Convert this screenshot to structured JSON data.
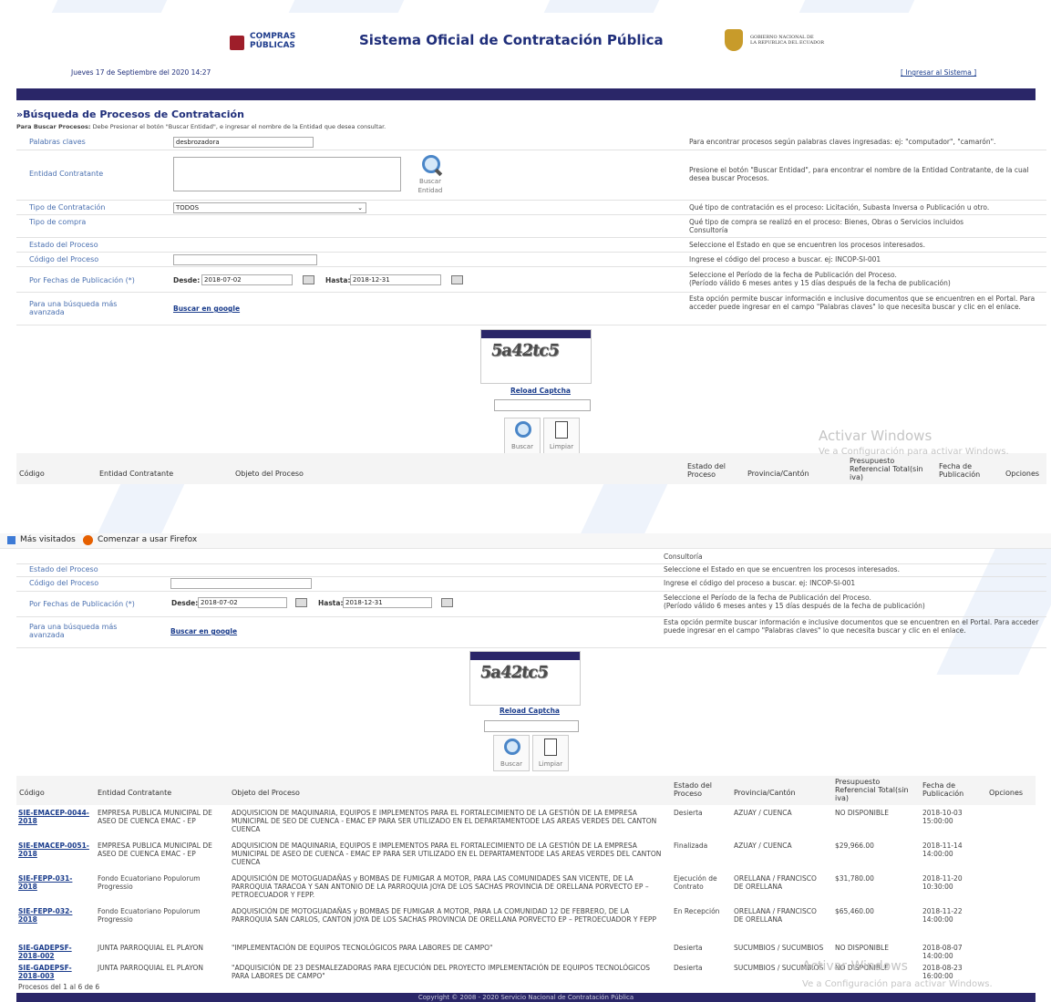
{
  "colors": {
    "band": "#2a2668",
    "link": "#1a3c8c",
    "label": "#4a70b0"
  },
  "header": {
    "logo_text_1": "COMPRAS",
    "logo_text_2": "PÚBLICAS",
    "title": "Sistema Oficial de Contratación Pública",
    "gov_text_1": "GOBIERNO NACIONAL DE",
    "gov_text_2": "LA REPUBLICA DEL ECUADOR",
    "date": "Jueves 17 de Septiembre del 2020 14:27",
    "login_link": "[ Ingresar al Sistema ]"
  },
  "search": {
    "title": "»Búsqueda de Procesos de Contratación",
    "instructions_bold": "Para Buscar Procesos:",
    "instructions": "Debe Presionar el botón \"Buscar Entidad\", e ingresar el nombre de la Entidad que desea consultar.",
    "keywords_label": "Palabras claves",
    "keywords_value": "desbrozadora",
    "keywords_help": "Para encontrar procesos según palabras claves ingresadas: ej: \"computador\", \"camarón\".",
    "entity_label": "Entidad Contratante",
    "entity_button_1": "Buscar",
    "entity_button_2": "Entidad",
    "entity_help": "Presione el botón \"Buscar Entidad\", para encontrar el nombre de la Entidad Contratante, de la cual desea buscar Procesos.",
    "contract_type_label": "Tipo de Contratación",
    "contract_type_value": "TODOS",
    "contract_type_help": "Qué tipo de contratación es el proceso: Licitación, Subasta Inversa o Publicación u otro.",
    "purchase_type_label": "Tipo de compra",
    "purchase_type_help": "Qué tipo de compra se realizó en el proceso: Bienes, Obras o Servicios incluidos Consultoría",
    "state_label": "Estado del Proceso",
    "state_help": "Seleccione el Estado en que se encuentren los procesos interesados.",
    "code_label": "Código del Proceso",
    "code_help": "Ingrese el código del proceso a buscar. ej: INCOP-SI-001",
    "dates_label": "Por Fechas de Publicación (*)",
    "from_label": "Desde:",
    "from_value": "2018-07-02",
    "to_label": "Hasta:",
    "to_value": "2018-12-31",
    "dates_help_1": "Seleccione el Período de la fecha de Publicación del Proceso.",
    "dates_help_2": "(Período válido 6 meses antes y 15 días después de la fecha de publicación)",
    "advanced_label": "Para una búsqueda más avanzada",
    "google_link": "Buscar en google",
    "advanced_help": "Esta opción permite buscar información e inclusive documentos que se encuentren en el Portal. Para acceder puede ingresar en el campo \"Palabras claves\" lo que necesita buscar y clic en el enlace.",
    "captcha_text": "5a42tc5",
    "reload_captcha": "Reload Captcha",
    "search_button": "Buscar",
    "clear_button": "Limpiar"
  },
  "browser": {
    "bookmark_1": "Más visitados",
    "bookmark_2": "Comenzar a usar Firefox"
  },
  "table": {
    "headers": [
      "Código",
      "Entidad Contratante",
      "Objeto del Proceso",
      "Estado del Proceso",
      "Provincia/Cantón",
      "Presupuesto Referencial Total(sin iva)",
      "Fecha de Publicación",
      "Opciones"
    ],
    "rows": [
      {
        "code": "SIE-EMACEP-0044-2018",
        "entity": "EMPRESA PUBLICA MUNICIPAL DE ASEO DE CUENCA EMAC - EP",
        "object": "ADQUISICION DE MAQUINARIA, EQUIPOS E IMPLEMENTOS PARA EL FORTALECIMIENTO DE LA GESTIÓN DE LA EMPRESA MUNICIPAL DE SEO DE CUENCA - EMAC EP PARA SER UTILIZADO EN EL DEPARTAMENTODE LAS AREAS VERDES DEL CANTON CUENCA",
        "state": "Desierta",
        "province": "AZUAY / CUENCA",
        "budget": "NO DISPONIBLE",
        "date": "2018-10-03 15:00:00"
      },
      {
        "code": "SIE-EMACEP-0051-2018",
        "entity": "EMPRESA PUBLICA MUNICIPAL DE ASEO DE CUENCA EMAC - EP",
        "object": "ADQUISICION DE MAQUINARIA, EQUIPOS E IMPLEMENTOS PARA EL FORTALECIMIENTO DE LA GESTIÓN DE LA EMPRESA MUNICIPAL DE ASEO DE CUENCA - EMAC EP PARA SER UTILIZADO EN EL DEPARTAMENTODE LAS AREAS VERDES DEL CANTON CUENCA",
        "state": "Finalizada",
        "province": "AZUAY / CUENCA",
        "budget": "$29,966.00",
        "date": "2018-11-14 14:00:00"
      },
      {
        "code": "SIE-FEPP-031-2018",
        "entity": "Fondo Ecuatoriano Populorum Progressio",
        "object": "ADQUISICIÓN DE MOTOGUADAÑAS y BOMBAS DE FUMIGAR A MOTOR, PARA LAS COMUNIDADES SAN VICENTE, DE LA PARROQUIA TARACOA Y SAN ANTONIO DE LA PARROQUIA JOYA DE LOS SACHAS PROVINCIA DE ORELLANA PORVECTO EP – PETROECUADOR Y FEPP.",
        "state": "Ejecución de Contrato",
        "province": "ORELLANA / FRANCISCO DE ORELLANA",
        "budget": "$31,780.00",
        "date": "2018-11-20 10:30:00"
      },
      {
        "code": "SIE-FEPP-032-2018",
        "entity": "Fondo Ecuatoriano Populorum Progressio",
        "object": "ADQUISICIÓN DE MOTOGUADAÑAS y BOMBAS DE FUMIGAR A MOTOR, PARA LA COMUNIDAD 12 DE FEBRERO, DE LA PARROQUIA SAN CARLOS, CANTON JOYA DE LOS SACHAS PROVINCIA DE ORELLANA PORVECTO EP – PETROECUADOR Y FEPP",
        "state": "En Recepción",
        "province": "ORELLANA / FRANCISCO DE ORELLANA",
        "budget": "$65,460.00",
        "date": "2018-11-22 14:00:00"
      },
      {
        "code": "SIE-GADEPSF-2018-002",
        "entity": "JUNTA PARROQUIAL EL PLAYON",
        "object": "\"IMPLEMENTACIÓN DE EQUIPOS TECNOLÓGICOS PARA LABORES DE CAMPO\"",
        "state": "Desierta",
        "province": "SUCUMBIOS / SUCUMBIOS",
        "budget": "NO DISPONIBLE",
        "date": "2018-08-07 14:00:00"
      },
      {
        "code": "SIE-GADEPSF-2018-003",
        "entity": "JUNTA PARROQUIAL EL PLAYON",
        "object": "\"ADQUISICIÓN DE 23 DESMALEZADORAS PARA EJECUCIÓN DEL PROYECTO IMPLEMENTACIÓN DE EQUIPOS TECNOLÓGICOS PARA LABORES DE CAMPO\"",
        "state": "Desierta",
        "province": "SUCUMBIOS / SUCUMBIOS",
        "budget": "NO DISPONIBLE",
        "date": "2018-08-23 16:00:00"
      }
    ],
    "summary": "Procesos del 1 al 6 de 6"
  },
  "footer": {
    "copyright": "Copyright © 2008 - 2020 Servicio Nacional de Contratación Pública"
  },
  "watermark": {
    "line1": "Activar Windows",
    "line2": "Ve a Configuración para activar Windows."
  }
}
